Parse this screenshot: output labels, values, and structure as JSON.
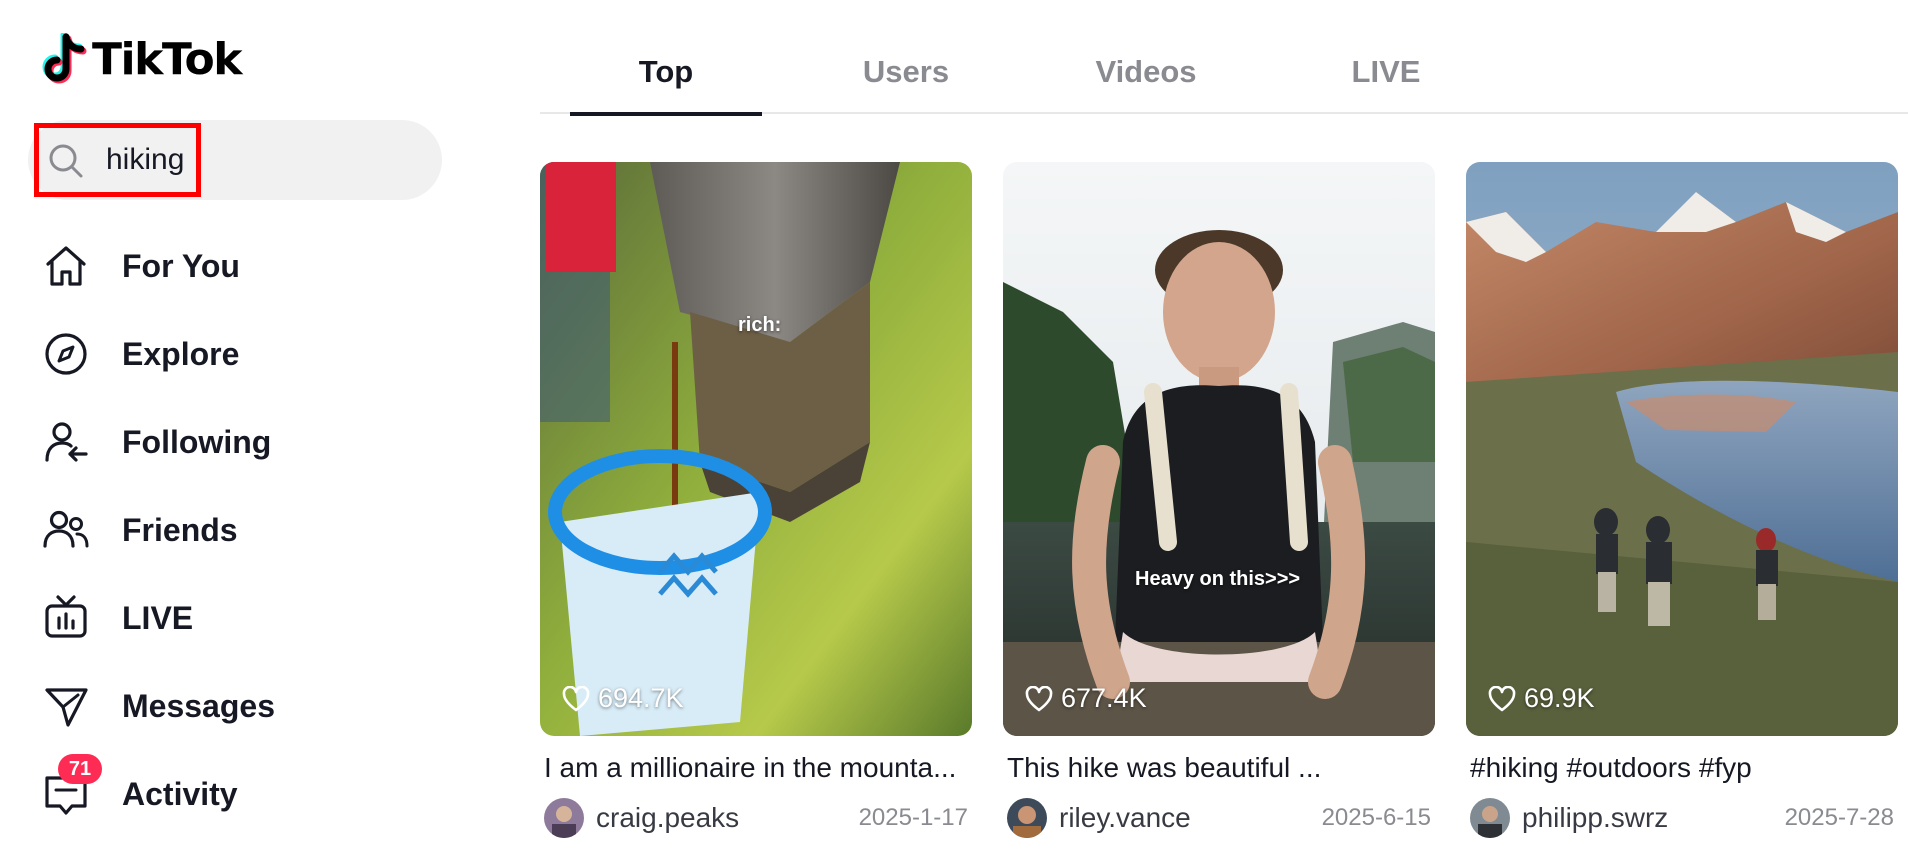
{
  "app": {
    "name": "TikTok"
  },
  "search": {
    "query": "hiking"
  },
  "nav": {
    "items": [
      {
        "label": "For You",
        "icon": "home-icon"
      },
      {
        "label": "Explore",
        "icon": "compass-icon"
      },
      {
        "label": "Following",
        "icon": "following-icon"
      },
      {
        "label": "Friends",
        "icon": "friends-icon"
      },
      {
        "label": "LIVE",
        "icon": "live-tv-icon"
      },
      {
        "label": "Messages",
        "icon": "paper-plane-icon"
      },
      {
        "label": "Activity",
        "icon": "activity-icon",
        "badge": "71"
      }
    ]
  },
  "tabs": [
    {
      "label": "Top",
      "active": true
    },
    {
      "label": "Users",
      "active": false
    },
    {
      "label": "Videos",
      "active": false
    },
    {
      "label": "LIVE",
      "active": false
    }
  ],
  "videos": [
    {
      "overlay": "rich:",
      "likes": "694.7K",
      "caption": "I am a millionaire in the mounta...",
      "username": "craig.peaks",
      "date": "2025-1-17"
    },
    {
      "overlay": "Heavy on this>>>",
      "likes": "677.4K",
      "caption": "This hike was beautiful ...",
      "username": "riley.vance",
      "date": "2025-6-15"
    },
    {
      "overlay": "",
      "likes": "69.9K",
      "caption": "#hiking #outdoors #fyp",
      "username": "philipp.swrz",
      "date": "2025-7-28"
    }
  ],
  "colors": {
    "accent": "#fe2c55",
    "cyan": "#25f4ee",
    "text": "#161823",
    "muted": "#8a8b91",
    "highlight": "#ff0000"
  }
}
